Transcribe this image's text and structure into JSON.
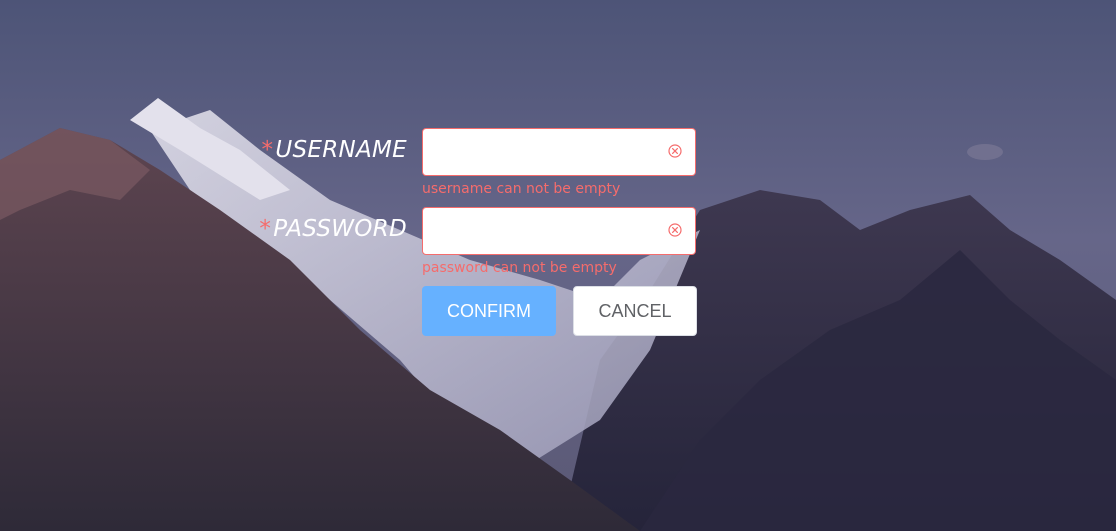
{
  "form": {
    "username": {
      "required_mark": "*",
      "label": "USERNAME",
      "value": "",
      "placeholder": "",
      "error": "username can not be empty"
    },
    "password": {
      "required_mark": "*",
      "label": "PASSWORD",
      "value": "",
      "placeholder": "",
      "error": "password can not be empty"
    },
    "confirm_label": "CONFIRM",
    "cancel_label": "CANCEL"
  },
  "colors": {
    "error": "#f56c6c",
    "primary_light": "#66b1ff",
    "label": "#ffffff"
  },
  "icons": {
    "clear": "circle-close-icon"
  }
}
